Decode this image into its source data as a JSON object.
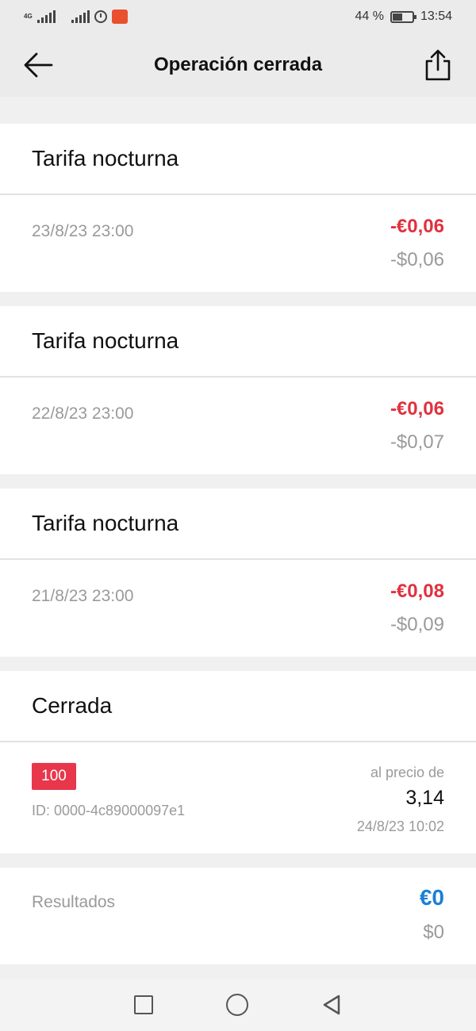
{
  "status_bar": {
    "net_label": "4G",
    "battery_pct": "44 %",
    "time": "13:54",
    "icons": [
      "signal-icon",
      "alarm-icon",
      "app-notification-icon",
      "battery-icon"
    ]
  },
  "header": {
    "title": "Operación cerrada",
    "back_icon": "arrow-left-icon",
    "share_icon": "share-icon"
  },
  "fees": [
    {
      "title": "Tarifa nocturna",
      "date": "23/8/23 23:00",
      "eur": "-€0,06",
      "usd": "-$0,06"
    },
    {
      "title": "Tarifa nocturna",
      "date": "22/8/23 23:00",
      "eur": "-€0,06",
      "usd": "-$0,07"
    },
    {
      "title": "Tarifa nocturna",
      "date": "21/8/23 23:00",
      "eur": "-€0,08",
      "usd": "-$0,09"
    }
  ],
  "closed": {
    "title": "Cerrada",
    "quantity": "100",
    "id": "ID: 0000-4c89000097e1",
    "price_label": "al precio de",
    "price": "3,14",
    "date": "24/8/23 10:02"
  },
  "results": {
    "label": "Resultados",
    "eur": "€0",
    "usd": "$0"
  },
  "colors": {
    "negative": "#e0313e",
    "neutral_result": "#1a7fd9",
    "badge": "#e8364a",
    "muted": "#9a9a9a"
  }
}
